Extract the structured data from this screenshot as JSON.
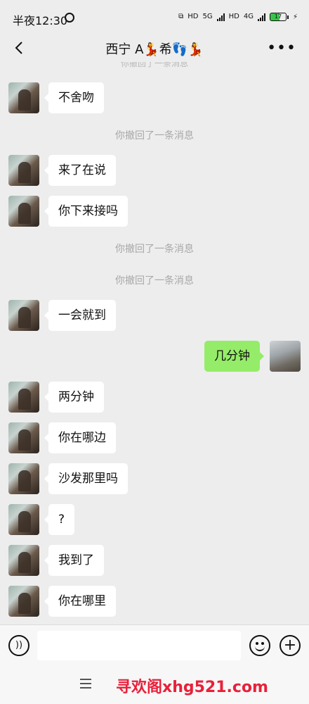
{
  "status_bar": {
    "time": "半夜12:30",
    "network_1": "HD",
    "network_2": "5G",
    "network_3": "HD",
    "network_4": "4G",
    "battery": "17"
  },
  "header": {
    "title": "西宁 A💃希👣💃"
  },
  "faded_top_text": "你撤回了一条消息",
  "messages": [
    {
      "type": "in",
      "text": "不舍吻"
    },
    {
      "type": "system",
      "text": "你撤回了一条消息"
    },
    {
      "type": "in",
      "text": "来了在说"
    },
    {
      "type": "in",
      "text": "你下来接吗"
    },
    {
      "type": "system",
      "text": "你撤回了一条消息"
    },
    {
      "type": "system",
      "text": "你撤回了一条消息"
    },
    {
      "type": "in",
      "text": "一会就到"
    },
    {
      "type": "out",
      "text": "几分钟"
    },
    {
      "type": "in",
      "text": "两分钟"
    },
    {
      "type": "in",
      "text": "你在哪边"
    },
    {
      "type": "in",
      "text": "沙发那里吗"
    },
    {
      "type": "in",
      "text": "?"
    },
    {
      "type": "in",
      "text": "我到了"
    },
    {
      "type": "in",
      "text": "你在哪里"
    }
  ],
  "input": {
    "value": "",
    "placeholder": ""
  },
  "watermark": "寻欢阁xhg521.com",
  "colors": {
    "outgoing_bubble": "#95ec69",
    "incoming_bubble": "#ffffff",
    "background": "#ededed",
    "watermark": "#e8203a"
  }
}
